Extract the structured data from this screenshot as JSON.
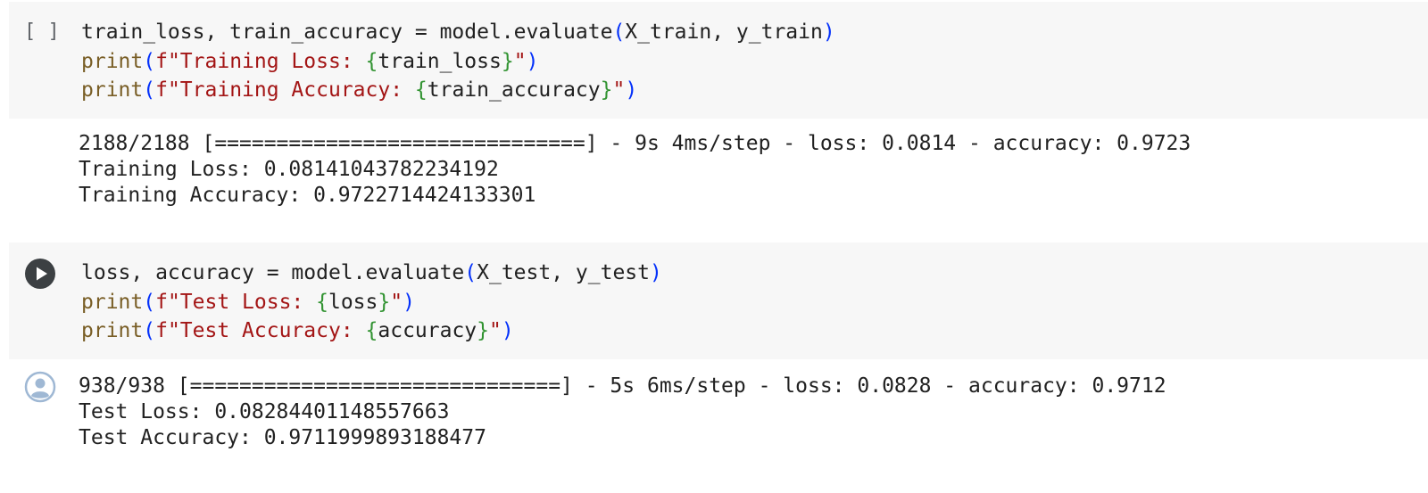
{
  "cells": [
    {
      "prompt": "[ ]",
      "code": {
        "line1": {
          "lhs": "train_loss, train_accuracy = model.evaluate",
          "open": "(",
          "args": "X_train, y_train",
          "close": ")"
        },
        "line2": {
          "fn": "print",
          "open": "(",
          "str_start": "f\"Training Loss: ",
          "brace_open": "{",
          "var": "train_loss",
          "brace_close": "}",
          "str_end": "\"",
          "close": ")"
        },
        "line3": {
          "fn": "print",
          "open": "(",
          "str_start": "f\"Training Accuracy: ",
          "brace_open": "{",
          "var": "train_accuracy",
          "brace_close": "}",
          "str_end": "\"",
          "close": ")"
        }
      },
      "output": [
        "2188/2188 [==============================] - 9s 4ms/step - loss: 0.0814 - accuracy: 0.9723",
        "Training Loss: 0.08141043782234192",
        "Training Accuracy: 0.9722714424133301"
      ]
    },
    {
      "run_icon": "play-icon",
      "code": {
        "line1": {
          "lhs": "loss, accuracy = model.evaluate",
          "open": "(",
          "args": "X_test, y_test",
          "close": ")"
        },
        "line2": {
          "fn": "print",
          "open": "(",
          "str_start": "f\"Test Loss: ",
          "brace_open": "{",
          "var": "loss",
          "brace_close": "}",
          "str_end": "\"",
          "close": ")"
        },
        "line3": {
          "fn": "print",
          "open": "(",
          "str_start": "f\"Test Accuracy: ",
          "brace_open": "{",
          "var": "accuracy",
          "brace_close": "}",
          "str_end": "\"",
          "close": ")"
        }
      },
      "output_icon": "user-avatar-icon",
      "output": [
        "938/938 [==============================] - 5s 6ms/step - loss: 0.0828 - accuracy: 0.9712",
        "Test Loss: 0.08284401148557663",
        "Test Accuracy: 0.9711999893188477"
      ]
    }
  ],
  "colors": {
    "code_bg": "#f7f7f7",
    "function": "#795e26",
    "string": "#a31515",
    "bracket": "#0431fa",
    "inner_brace": "#319331",
    "text": "#212121"
  }
}
